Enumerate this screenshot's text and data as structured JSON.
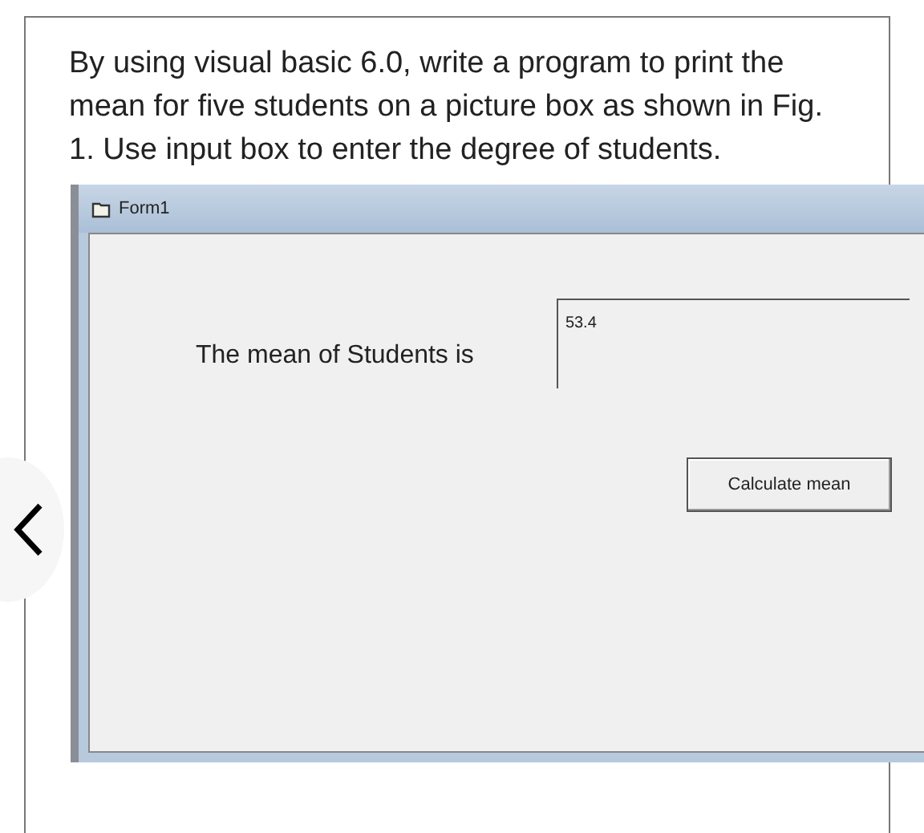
{
  "question": "By using visual basic 6.0, write a program to print the mean for five students on a picture box as shown in Fig. 1. Use input box to enter the degree of students.",
  "form": {
    "title": "Form1",
    "label": "The mean of Students is",
    "picture_box": {
      "value": "53.4"
    },
    "button": "Calculate mean"
  }
}
